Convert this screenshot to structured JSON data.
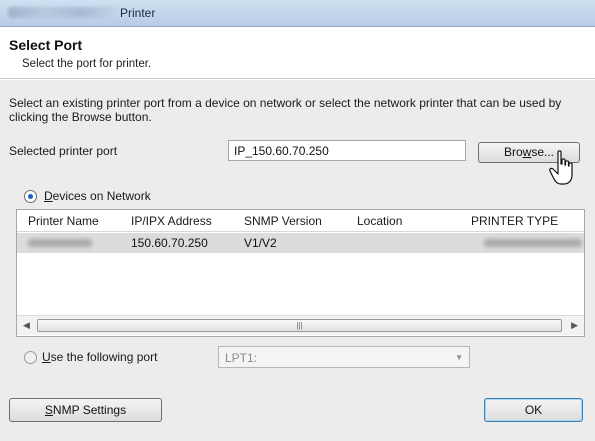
{
  "window": {
    "title": "Printer"
  },
  "header": {
    "title": "Select Port",
    "subtitle": "Select the port for printer."
  },
  "description": "Select an existing printer port from a device on network or select the network printer that can be used by clicking the Browse button.",
  "port": {
    "label": "Selected printer port",
    "value": "IP_150.60.70.250",
    "browse_label": "Browse..."
  },
  "devices": {
    "option_label": "Devices on Network",
    "selected": true,
    "columns": [
      "Printer Name",
      "IP/IPX Address",
      "SNMP Version",
      "Location",
      "PRINTER TYPE"
    ],
    "rows": [
      {
        "ip": "150.60.70.250",
        "snmp": "V1/V2",
        "location": ""
      }
    ]
  },
  "use_port": {
    "option_label": "Use the following port",
    "selected": false,
    "value": "LPT1:"
  },
  "buttons": {
    "snmp": "SNMP Settings",
    "ok": "OK"
  }
}
